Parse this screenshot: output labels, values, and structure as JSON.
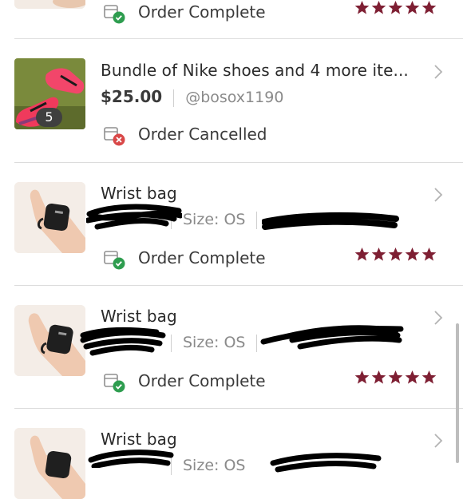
{
  "orders": [
    {
      "status": "Order Complete",
      "rating": 5
    },
    {
      "title": "Bundle of Nike shoes and 4 more ite...",
      "price": "$25.00",
      "seller": "@bosox1190",
      "badge_count": "5",
      "status": "Order Cancelled"
    },
    {
      "title": "Wrist bag",
      "size": "Size: OS",
      "status": "Order Complete",
      "rating": 5
    },
    {
      "title": "Wrist bag",
      "size": "Size: OS",
      "status": "Order Complete",
      "rating": 5
    },
    {
      "title": "Wrist bag",
      "size": "Size: OS"
    }
  ],
  "colors": {
    "star": "#7e1f33",
    "complete_badge": "#2e9d4f",
    "cancelled_badge": "#d94848",
    "divider": "#dcdcdc"
  },
  "icons": {
    "chevron": "chevron-right-icon",
    "star": "star-icon",
    "order_complete": "order-complete-icon",
    "order_cancelled": "order-cancelled-icon"
  }
}
